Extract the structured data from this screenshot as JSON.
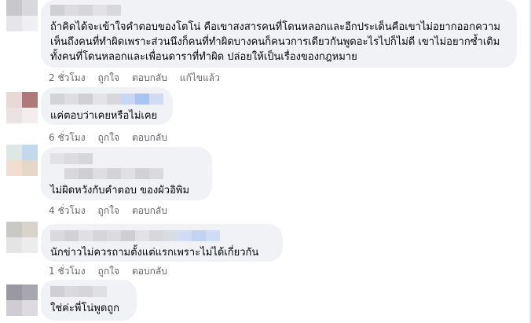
{
  "comments": [
    {
      "text": "ถ้าคิดได้จะเข้าใจคำตอบของโตโน่ คือเขาสงสารคนที่โดนหลอกและอีกประเด็นคือเขาไม่อยากออกความเห็นถึงคนที่ทำผิดเพราะส่วนนึงก็คนที่ทำผิดบางคนก็คนวการเดียวกันพูดอะไรไปก็ไม่ดี เขาไม่อยากซ้ำเติมทั้งคนที่โดนหลอกและเพื่อนดาราที่ทำผิด ปล่อยให้เป็นเรื่องของกฎหมาย",
      "time": "2 ชั่วโมง",
      "like": "ถูกใจ",
      "reply": "ตอบกลับ",
      "edited": "แก้ไขแล้ว"
    },
    {
      "text": "แค่ตอบว่าเคยหรือไม่เคย",
      "time": "6 ชั่วโมง",
      "like": "ถูกใจ",
      "reply": "ตอบกลับ"
    },
    {
      "text": "ไม่ผิดหวังกับคำตอบ ของผัวอิพิม",
      "time": "4 ชั่วโมง",
      "like": "ถูกใจ",
      "reply": "ตอบกลับ"
    },
    {
      "text": "นักข่าวไม่ควรถามตั้งแต่แรกเพราะไม่ได้เกี่ยวกัน",
      "time": "1 ชั่วโมง",
      "like": "ถูกใจ",
      "reply": "ตอบกลับ"
    },
    {
      "text": "ใช่ค่ะพี่โน่พูดถูก"
    }
  ],
  "colors": {
    "bubble": "#f0f2f5",
    "meta_text": "#65676b",
    "body_text": "#050505"
  }
}
